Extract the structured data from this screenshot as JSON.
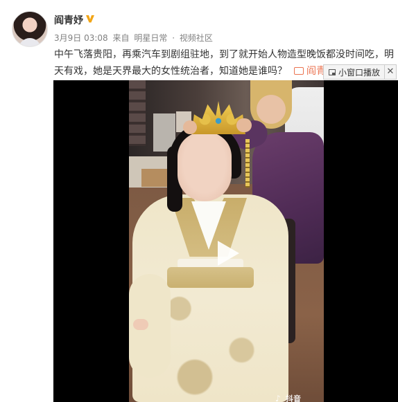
{
  "author": {
    "name": "阎青妤",
    "verified_badge": "V",
    "badge_color": "#f2a516",
    "avatar_icon": "user-avatar"
  },
  "meta": {
    "date": "3月9日 03:08",
    "from": "来自",
    "client": "明星日常",
    "separator": "·",
    "community": "视频社区"
  },
  "post": {
    "line1": "中午飞落贵阳，再乘汽车到剧组驻地，到了就开始人物造型晚饭都没时间吃，明",
    "line2": "天有戏，她是天界最大的女性统治者，知道她是谁吗？",
    "video_tag": "阎青",
    "tag_color": "#eb7350"
  },
  "mini_window": {
    "label": "小窗口播放",
    "close": "✕"
  },
  "video": {
    "play_icon": "play-icon",
    "watermark": "抖音",
    "background": "#000000"
  }
}
